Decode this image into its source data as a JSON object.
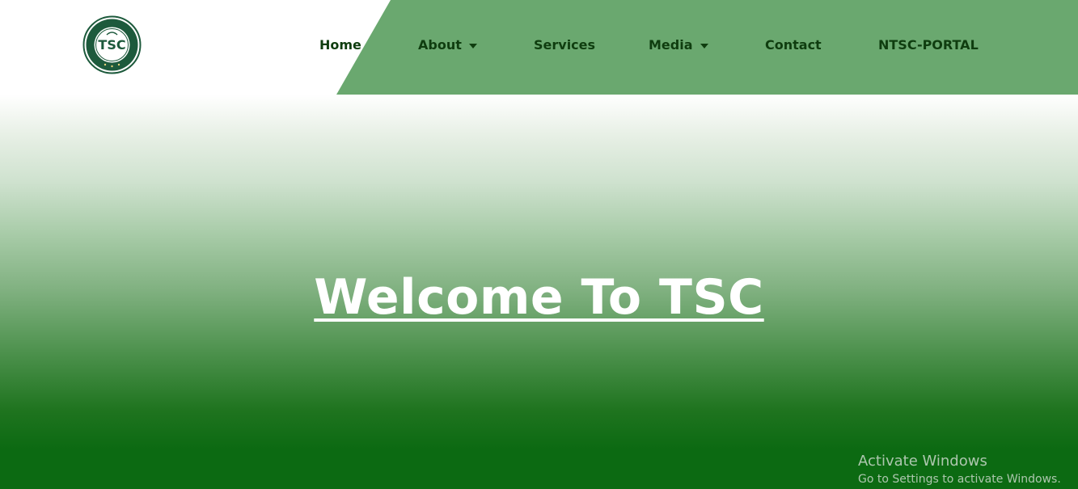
{
  "brand": {
    "logo_text": "TSC",
    "logo_ring_text": "Teachers Service Commission"
  },
  "nav": {
    "items": [
      {
        "label": "Home",
        "has_dropdown": false
      },
      {
        "label": "About",
        "has_dropdown": true
      },
      {
        "label": "Services",
        "has_dropdown": false
      },
      {
        "label": "Media",
        "has_dropdown": true
      },
      {
        "label": "Contact",
        "has_dropdown": false
      },
      {
        "label": "NTSC-PORTAL",
        "has_dropdown": false
      }
    ]
  },
  "hero": {
    "title": "Welcome To TSC"
  },
  "watermark": {
    "title": "Activate Windows",
    "subtitle": "Go to Settings to activate Windows."
  },
  "colors": {
    "header_band": "#6aa86f",
    "nav_text": "#0f3d0f",
    "hero_bottom": "#0c6a12",
    "logo_dark": "#1d5a3c"
  },
  "icons": {
    "dropdown": "caret-down-icon"
  }
}
